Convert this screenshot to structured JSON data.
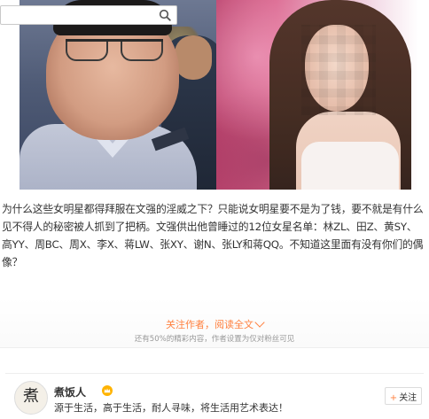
{
  "search": {
    "value": "",
    "placeholder": "",
    "icon": "search-icon"
  },
  "article": {
    "body": "为什么这些女明星都得拜服在文强的淫威之下？只能说女明星要不是为了钱，要不就是有什么见不得人的秘密被人抓到了把柄。文强供出他曾睡过的12位女星名单：林ZL、田Z、黄SY、高YY、周BC、周X、李X、蒋LW、张XY、谢N、张LY和蒋QQ。不知道这里面有没有你们的偶像？"
  },
  "read_more": {
    "label": "关注作者，阅读全文",
    "note": "还有50%的精彩内容，作者设置为仅对粉丝可见",
    "accent": "#ff8140"
  },
  "author": {
    "name": "煮饭人",
    "bio": "源于生活，高于生活，耐人寻味，将生活用艺术表达！",
    "avatar_text": "煮",
    "vip_icon": "crown-badge-icon",
    "follow_label": "关注",
    "follow_icon": "plus-icon"
  }
}
